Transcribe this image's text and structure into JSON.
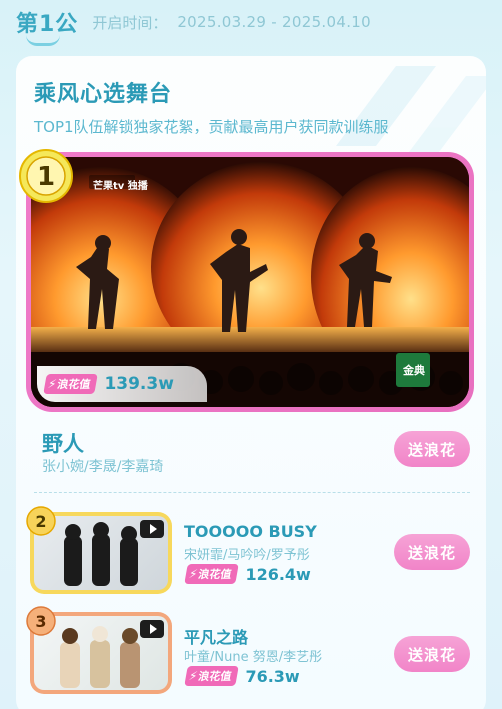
{
  "header": {
    "round": "第1公",
    "time_label": "开启时间：",
    "time_range": "2025.03.29 - 2025.04.10"
  },
  "section": {
    "title": "乘风心选舞台",
    "subtitle": "TOP1队伍解锁独家花絮，贡献最高用户获同款训练服"
  },
  "featured": {
    "rank": "1",
    "platform_tag": "芒果tv 独播",
    "brand_tag": "金典",
    "wave_label": "浪花值",
    "wave_value": "139.3w",
    "song": "野人",
    "artists": "张小婉/李晟/李嘉琦",
    "button": "送浪花"
  },
  "rankings": [
    {
      "rank": "2",
      "song": "TOOOOO BUSY",
      "artists": "宋妍霏/马吟吟/罗予彤",
      "wave_label": "浪花值",
      "wave_value": "126.4w",
      "button": "送浪花"
    },
    {
      "rank": "3",
      "song": "平凡之路",
      "artists": "叶童/Nune 努恩/李艺彤",
      "wave_label": "浪花值",
      "wave_value": "76.3w",
      "button": "送浪花"
    }
  ],
  "colors": {
    "accent": "#2b9ab6",
    "pink": "#f184c8",
    "gold": "#f3d233",
    "silver": "#f0a94c",
    "bronze": "#f08a5a"
  },
  "icons": [
    "play-icon",
    "lightning-icon",
    "rank-medal-icon"
  ]
}
